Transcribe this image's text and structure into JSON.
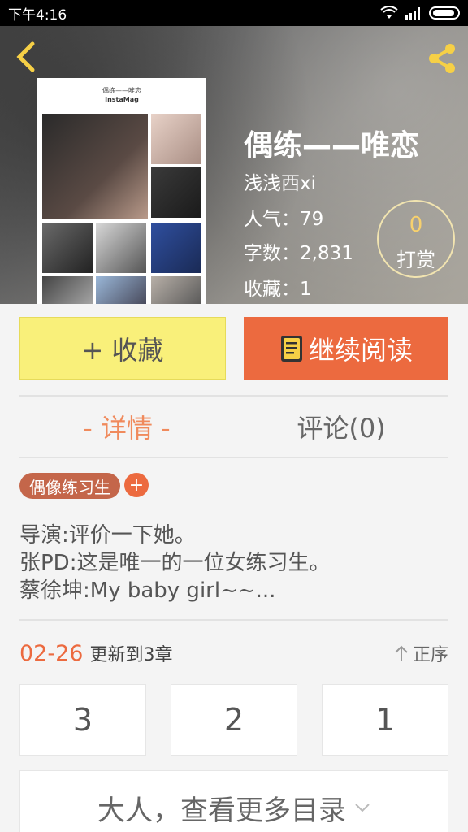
{
  "statusbar": {
    "time": "下午4:16"
  },
  "header": {
    "back_icon": "chevron-left-icon",
    "share_icon": "share-icon"
  },
  "cover": {
    "caption_line1": "偶练——唯恋",
    "caption_line2": "InstaMag"
  },
  "book": {
    "title": "偶练——唯恋",
    "author": "浅浅西xi",
    "popularity": "人气：79",
    "word_count": "字数：2,831",
    "favorites": "收藏：1"
  },
  "tip": {
    "count": "0",
    "label": "打赏"
  },
  "actions": {
    "favorite_label": "+ 收藏",
    "read_label": "继续阅读"
  },
  "tabs": {
    "detail": "- 详情 -",
    "comment": "评论(0)"
  },
  "tags": {
    "tag1": "偶像练习生",
    "add": "+"
  },
  "description": {
    "line1": "导演:评价一下她。",
    "line2": "张PD:这是唯一的一位女练习生。",
    "line3": "蔡徐坤:My baby girl~~..."
  },
  "update": {
    "date": "02-26",
    "text": "更新到3章",
    "sort_label": "正序"
  },
  "chapters": [
    "3",
    "2",
    "1"
  ],
  "more": {
    "label": "大人，查看更多目录"
  },
  "colors": {
    "accent": "#ec6a3f",
    "fav_bg": "#f9f07a",
    "tag_bg": "#c4664a",
    "tab_active": "#f08a5c"
  }
}
